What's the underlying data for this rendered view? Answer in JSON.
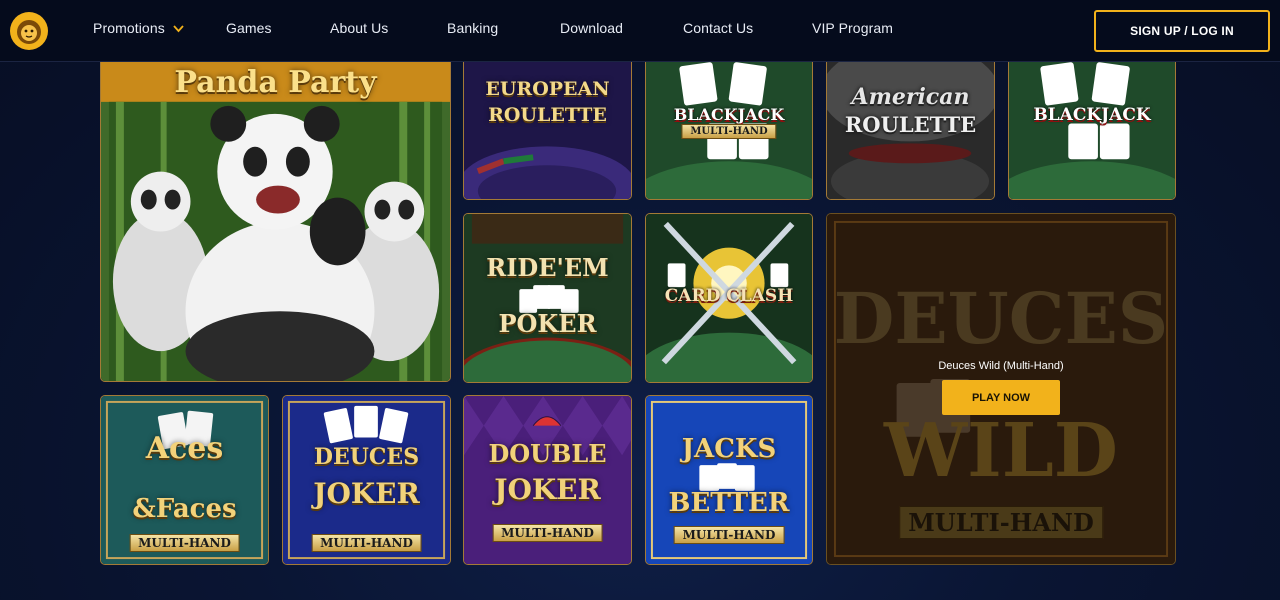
{
  "header": {
    "nav": [
      {
        "label": "Promotions",
        "has_dropdown": true
      },
      {
        "label": "Games"
      },
      {
        "label": "About Us"
      },
      {
        "label": "Banking"
      },
      {
        "label": "Download"
      },
      {
        "label": "Contact Us"
      },
      {
        "label": "VIP Program"
      }
    ],
    "signup_label": "SIGN UP / LOG IN"
  },
  "colors": {
    "accent": "#f2b21b",
    "header_bg": "#050b1c",
    "page_bg": "#0a1533"
  },
  "games": [
    {
      "art_title": "Panda Party"
    },
    {
      "art_title": "EUROPEAN",
      "art_title2": "ROULETTE"
    },
    {
      "art_title": "BLACKJACK",
      "art_sub": "MULTI-HAND"
    },
    {
      "art_title": "American",
      "art_title2": "ROULETTE"
    },
    {
      "art_title": "BLACKJACK"
    },
    {
      "art_title": "RIDE'EM",
      "art_title2": "POKER"
    },
    {
      "art_title": "CARD CLASH"
    },
    {
      "art_title": "Aces",
      "art_title2": "&Faces",
      "art_sub": "MULTI-HAND"
    },
    {
      "art_title": "DEUCES",
      "art_title2": "JOKER",
      "art_sub": "MULTI-HAND"
    },
    {
      "art_title": "DOUBLE",
      "art_title2": "JOKER",
      "art_sub": "MULTI-HAND"
    },
    {
      "art_title": "JACKS",
      "art_title2": "BETTER",
      "art_sub": "MULTI-HAND"
    }
  ],
  "featured": {
    "title": "Deuces Wild (Multi-Hand)",
    "play_label": "PLAY NOW",
    "art_title": "DEUCES",
    "art_title2": "WILD",
    "art_sub": "MULTI-HAND"
  }
}
